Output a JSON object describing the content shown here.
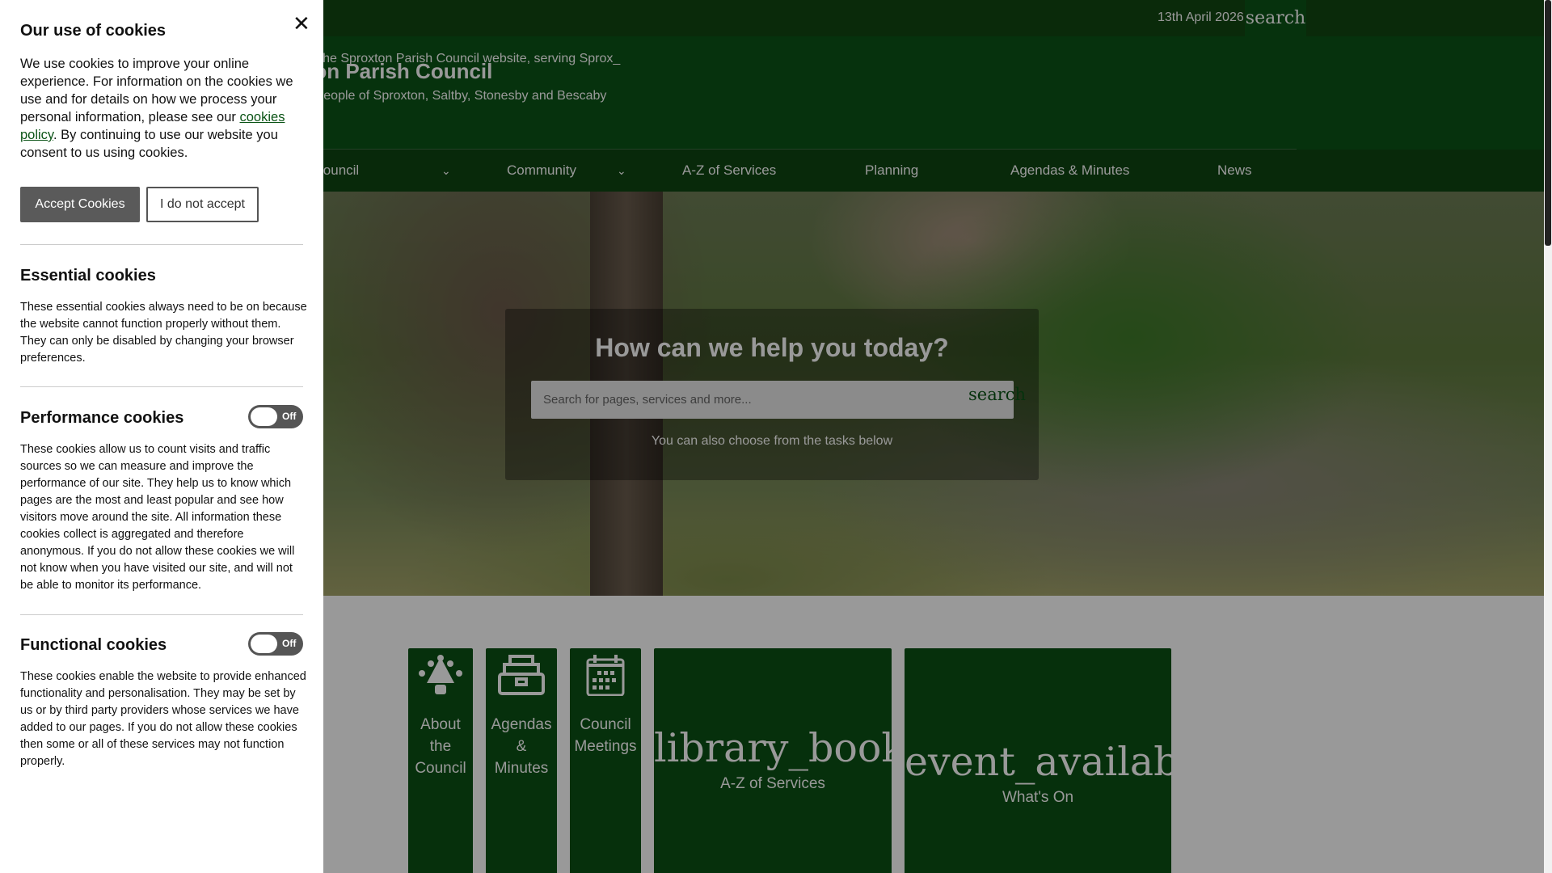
{
  "header": {
    "date": "13th April 2026",
    "top_search": "search",
    "welcome": "Welcome to the Sproxton Parish Council website, serving Sprox_",
    "title": "Sproxton Parish Council",
    "tagline": "Serving the people of Sproxton, Saltby, Stonesby and Bescaby"
  },
  "nav": [
    {
      "label": "About the Council"
    },
    {
      "label": "Community"
    },
    {
      "label": "A-Z of Services"
    },
    {
      "label": "Planning"
    },
    {
      "label": "Agendas & Minutes"
    },
    {
      "label": "News"
    }
  ],
  "hero": {
    "title": "How can we help you today?",
    "search_placeholder": "Search for pages, services and more...",
    "search_button": "search",
    "subtitle": "You can also choose from the tasks below"
  },
  "tiles": [
    {
      "label_lines": [
        "About",
        "the",
        "Council"
      ],
      "icon": "meeting-table-icon"
    },
    {
      "label_lines": [
        "Agendas",
        "&",
        "Minutes"
      ],
      "icon": "archive-drawer-icon"
    },
    {
      "label_lines": [
        "Council",
        "Meetings"
      ],
      "icon": "calendar-icon"
    },
    {
      "glyph": "library_books",
      "label": "A-Z of Services"
    },
    {
      "glyph": "event_available",
      "label": "What's On"
    }
  ],
  "cookie": {
    "title": "Our use of cookies",
    "intro_before": "We use cookies to improve your online experience. For information on the cookies we use and for details on how we process your personal information, please see our ",
    "intro_link": "cookies policy",
    "intro_after": ". By continuing to use our website you consent to us using cookies.",
    "accept": "Accept Cookies",
    "decline": "I do not accept",
    "essential_title": "Essential cookies",
    "essential_text": "These essential cookies always need to be on because the website cannot function properly without them. They can only be disabled by changing your browser preferences.",
    "performance_title": "Performance cookies",
    "performance_state": "Off",
    "performance_text": "These cookies allow us to count visits and traffic sources so we can measure and improve the performance of our site. They help us to know which pages are the most and least popular and see how visitors move around the site. All information these cookies collect is aggregated and therefore anonymous. If you do not allow these cookies we will not know when you have visited our site, and will not be able to monitor its performance.",
    "functional_title": "Functional cookies",
    "functional_state": "Off",
    "functional_text": "These cookies enable the website to provide enhanced functionality and personalisation. They may be set by us or by third party providers whose services we have added to our pages. If you do not allow these cookies then some or all of these services may not function properly."
  }
}
